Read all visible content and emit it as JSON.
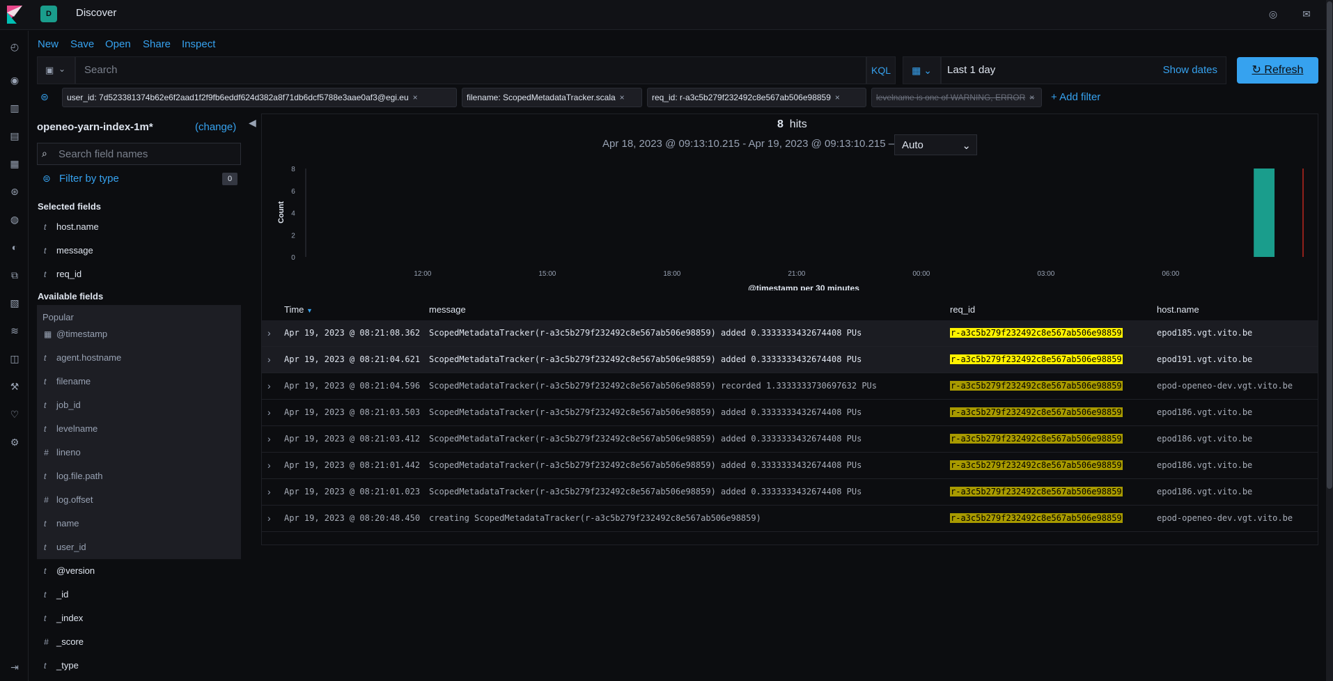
{
  "app": {
    "title": "Discover",
    "space_initial": "D"
  },
  "menu": {
    "new": "New",
    "save": "Save",
    "open": "Open",
    "share": "Share",
    "inspect": "Inspect"
  },
  "query": {
    "placeholder": "Search",
    "language": "KQL",
    "date_value": "Last 1 day",
    "show_dates": "Show dates",
    "refresh": "Refresh"
  },
  "filters": [
    {
      "label": "user_id: 7d523381374b62e6f2aad1f2f9fb6eddf624d382a8f71db6dcf5788e3aae0af3@egi.eu",
      "disabled": false
    },
    {
      "label": "filename: ScopedMetadataTracker.scala",
      "disabled": false
    },
    {
      "label": "req_id: r-a3c5b279f232492c8e567ab506e98859",
      "disabled": false
    },
    {
      "label": "levelname is one of WARNING, ERROR",
      "disabled": true
    }
  ],
  "add_filter": "+ Add filter",
  "sidebar": {
    "index_pattern": "openeo-yarn-index-1m*",
    "change": "(change)",
    "field_search_placeholder": "Search field names",
    "filter_by_type": "Filter by type",
    "filter_count": "0",
    "selected_header": "Selected fields",
    "selected": [
      {
        "type": "t",
        "name": "host.name"
      },
      {
        "type": "t",
        "name": "message"
      },
      {
        "type": "t",
        "name": "req_id"
      }
    ],
    "available_header": "Available fields",
    "popular_label": "Popular",
    "popular": [
      {
        "type": "▦",
        "name": "@timestamp"
      },
      {
        "type": "t",
        "name": "agent.hostname"
      },
      {
        "type": "t",
        "name": "filename"
      },
      {
        "type": "t",
        "name": "job_id"
      },
      {
        "type": "t",
        "name": "levelname"
      },
      {
        "type": "#",
        "name": "lineno"
      },
      {
        "type": "t",
        "name": "log.file.path"
      },
      {
        "type": "#",
        "name": "log.offset"
      },
      {
        "type": "t",
        "name": "name"
      },
      {
        "type": "t",
        "name": "user_id"
      }
    ],
    "others": [
      {
        "type": "t",
        "name": "@version"
      },
      {
        "type": "t",
        "name": "_id"
      },
      {
        "type": "t",
        "name": "_index"
      },
      {
        "type": "#",
        "name": "_score"
      },
      {
        "type": "t",
        "name": "_type"
      }
    ]
  },
  "hits": {
    "count": "8",
    "label": "hits"
  },
  "time_range": "Apr 18, 2023 @ 09:13:10.215 - Apr 19, 2023 @ 09:13:10.215 —",
  "interval": "Auto",
  "chart_data": {
    "type": "bar",
    "ylabel": "Count",
    "xlabel": "@timestamp per 30 minutes",
    "yticks": [
      "0",
      "2",
      "4",
      "6",
      "8"
    ],
    "xticks": [
      "12:00",
      "15:00",
      "18:00",
      "21:00",
      "00:00",
      "03:00",
      "06:00"
    ],
    "ylim": [
      0,
      8
    ],
    "x_range_hours": [
      9.22,
      33.22
    ],
    "bars": [
      {
        "start_hour": 32.0,
        "value": 8
      }
    ],
    "now_marker_hour": 33.22,
    "bar_color": "#1a9d8c"
  },
  "table": {
    "columns": {
      "time": "Time",
      "message": "message",
      "req_id": "req_id",
      "host": "host.name"
    },
    "highlight_color": "#e0c800",
    "rows": [
      {
        "time": "Apr 19, 2023 @ 08:21:08.362",
        "message": "ScopedMetadataTracker(r-a3c5b279f232492c8e567ab506e98859) added 0.3333333432674408 PUs",
        "req_id": "r-a3c5b279f232492c8e567ab506e98859",
        "host": "epod185.vgt.vito.be",
        "highlight": true
      },
      {
        "time": "Apr 19, 2023 @ 08:21:04.621",
        "message": "ScopedMetadataTracker(r-a3c5b279f232492c8e567ab506e98859) added 0.3333333432674408 PUs",
        "req_id": "r-a3c5b279f232492c8e567ab506e98859",
        "host": "epod191.vgt.vito.be",
        "highlight": true
      },
      {
        "time": "Apr 19, 2023 @ 08:21:04.596",
        "message": "ScopedMetadataTracker(r-a3c5b279f232492c8e567ab506e98859) recorded 1.3333333730697632 PUs",
        "req_id": "r-a3c5b279f232492c8e567ab506e98859",
        "host": "epod-openeo-dev.vgt.vito.be",
        "highlight": false
      },
      {
        "time": "Apr 19, 2023 @ 08:21:03.503",
        "message": "ScopedMetadataTracker(r-a3c5b279f232492c8e567ab506e98859) added 0.3333333432674408 PUs",
        "req_id": "r-a3c5b279f232492c8e567ab506e98859",
        "host": "epod186.vgt.vito.be",
        "highlight": false
      },
      {
        "time": "Apr 19, 2023 @ 08:21:03.412",
        "message": "ScopedMetadataTracker(r-a3c5b279f232492c8e567ab506e98859) added 0.3333333432674408 PUs",
        "req_id": "r-a3c5b279f232492c8e567ab506e98859",
        "host": "epod186.vgt.vito.be",
        "highlight": false
      },
      {
        "time": "Apr 19, 2023 @ 08:21:01.442",
        "message": "ScopedMetadataTracker(r-a3c5b279f232492c8e567ab506e98859) added 0.3333333432674408 PUs",
        "req_id": "r-a3c5b279f232492c8e567ab506e98859",
        "host": "epod186.vgt.vito.be",
        "highlight": false
      },
      {
        "time": "Apr 19, 2023 @ 08:21:01.023",
        "message": "ScopedMetadataTracker(r-a3c5b279f232492c8e567ab506e98859) added 0.3333333432674408 PUs",
        "req_id": "r-a3c5b279f232492c8e567ab506e98859",
        "host": "epod186.vgt.vito.be",
        "highlight": false
      },
      {
        "time": "Apr 19, 2023 @ 08:20:48.450",
        "message": "creating ScopedMetadataTracker(r-a3c5b279f232492c8e567ab506e98859)",
        "req_id": "r-a3c5b279f232492c8e567ab506e98859",
        "host": "epod-openeo-dev.vgt.vito.be",
        "highlight": false
      }
    ]
  },
  "rail_icons": [
    "clock-icon",
    "compass-icon",
    "visualize-icon",
    "dashboard-icon",
    "canvas-icon",
    "maps-icon",
    "ml-icon",
    "users-icon",
    "logs-icon",
    "infra-icon",
    "apm-icon",
    "security-icon",
    "devtools-icon",
    "monitoring-icon",
    "management-icon"
  ]
}
